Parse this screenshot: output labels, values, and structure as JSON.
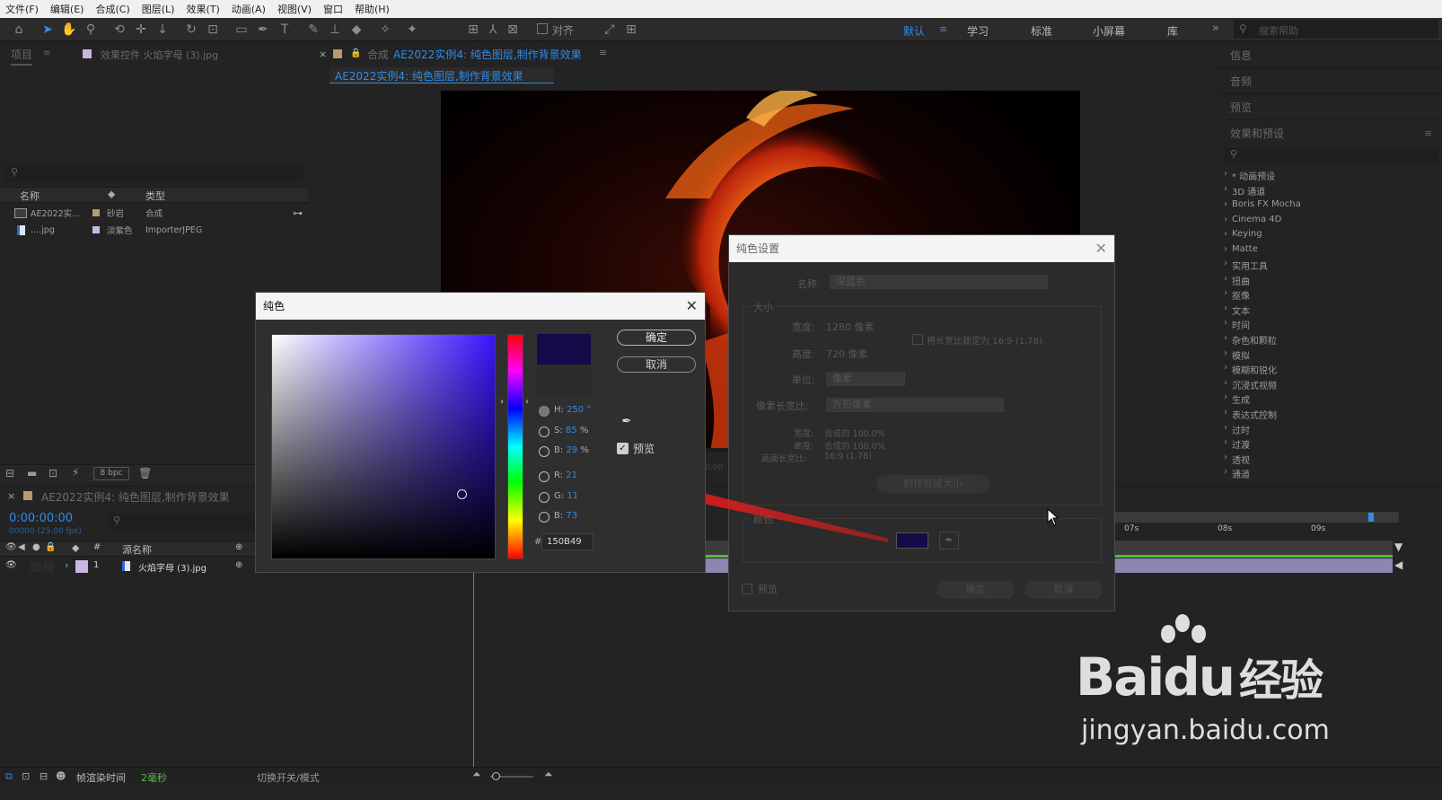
{
  "menu": [
    "文件(F)",
    "编辑(E)",
    "合成(C)",
    "图层(L)",
    "效果(T)",
    "动画(A)",
    "视图(V)",
    "窗口",
    "帮助(H)"
  ],
  "toolbar": {
    "align_label": "对齐",
    "workspaces": [
      "默认",
      "学习",
      "标准",
      "小屏幕",
      "库"
    ],
    "search_placeholder": "搜索帮助"
  },
  "project_panel": {
    "tab_project": "项目",
    "tab_effects": "效果控件 火焰字母 (3).jpg",
    "columns": [
      "名称",
      "类型"
    ],
    "items": [
      {
        "name": "AE2022实...",
        "label": "砂岩",
        "type": "合成"
      },
      {
        "name": "....jpg",
        "label": "淡紫色",
        "type": "ImporterJPEG"
      }
    ],
    "bpc": "8 bpc"
  },
  "composition": {
    "tab_prefix": "合成",
    "tab_title": "AE2022实例4: 纯色图层,制作背景效果",
    "breadcrumb": "AE2022实例4: 纯色图层,制作背景效果",
    "viewer_time": "0:00"
  },
  "timeline": {
    "tab_title": "AE2022实例4: 纯色图层,制作背景效果",
    "timecode": "0:00:00:00",
    "fps": "00000 (25.00 fps)",
    "col_source": "源名称",
    "layer_index": "1",
    "layer_name": "火焰字母 (3).jpg",
    "ruler_marks": [
      "07s",
      "08s",
      "09s"
    ],
    "footer_render": "帧渲染时间",
    "footer_ms": "2毫秒",
    "footer_toggle": "切换开关/模式"
  },
  "right_panel": {
    "info": "信息",
    "audio": "音频",
    "preview": "预览",
    "effects_presets": "效果和预设",
    "list": [
      "* 动画预设",
      "3D 通道",
      "Boris FX Mocha",
      "Cinema 4D",
      "Keying",
      "Matte",
      "实用工具",
      "扭曲",
      "抠像",
      "文本",
      "时间",
      "杂色和颗粒",
      "模拟",
      "模糊和锐化",
      "沉浸式视频",
      "生成",
      "表达式控制",
      "过时",
      "过渡",
      "透视",
      "通道"
    ]
  },
  "solid_settings": {
    "title": "纯色设置",
    "name_label": "名称:",
    "name_value": "深蓝色",
    "size_label": "大小",
    "width_label": "宽度:",
    "width_value": "1280 像素",
    "height_label": "高度:",
    "height_value": "720 像素",
    "lock_label": "将长宽比锁定为 16:9 (1.78)",
    "unit_label": "单位:",
    "unit_value": "像素",
    "pixel_aspect_label": "像素长宽比:",
    "pixel_aspect_value": "方形像素",
    "w_pct_label": "宽度:",
    "w_pct_value": "合成的 100.0%",
    "h_pct_label": "高度:",
    "h_pct_value": "合成的 100.0%",
    "frame_aspect_label": "画面长宽比:",
    "frame_aspect_value": "16:9 (1.78)",
    "make_comp_size": "制作合成大小",
    "color_label": "颜色",
    "preview_label": "预览",
    "ok": "确定",
    "cancel": "取消"
  },
  "color_picker": {
    "title": "纯色",
    "ok": "确定",
    "cancel": "取消",
    "preview_label": "预览",
    "h_label": "H:",
    "h_value": "250",
    "h_unit": "°",
    "s_label": "S:",
    "s_value": "85",
    "s_unit": "%",
    "b_label": "B:",
    "b_value": "29",
    "b_unit": "%",
    "r_label": "R:",
    "r_value": "21",
    "g_label": "G:",
    "g_value": "11",
    "b2_label": "B:",
    "b2_value": "73",
    "hex_prefix": "#",
    "hex_value": "150B49",
    "new_color": "#150b49",
    "old_color": "#2b2b2b"
  },
  "watermark": {
    "brand": "Bai",
    "brand_paw": "du",
    "cn": "经验",
    "url": "jingyan.baidu.com"
  }
}
